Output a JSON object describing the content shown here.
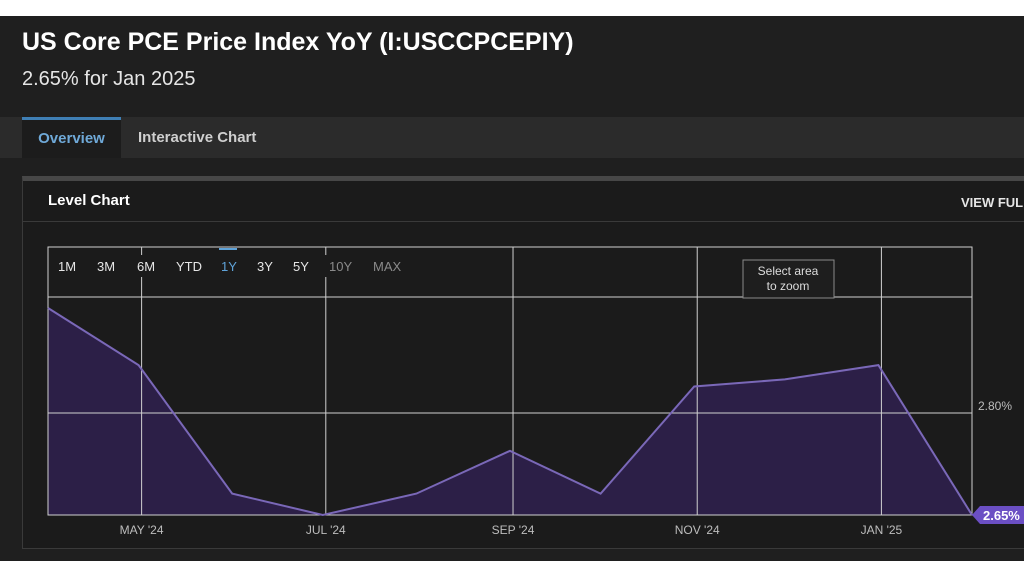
{
  "header": {
    "title": "US Core PCE Price Index YoY (I:USCCPCEPIY)",
    "subtitle": "2.65% for Jan 2025"
  },
  "tabs": [
    {
      "label": "Overview",
      "active": true
    },
    {
      "label": "Interactive Chart",
      "active": false
    }
  ],
  "panel": {
    "title": "Level Chart",
    "view_full_label": "VIEW FUL"
  },
  "range_buttons": [
    {
      "label": "1M",
      "state": "normal"
    },
    {
      "label": "3M",
      "state": "normal"
    },
    {
      "label": "6M",
      "state": "normal"
    },
    {
      "label": "YTD",
      "state": "normal"
    },
    {
      "label": "1Y",
      "state": "selected"
    },
    {
      "label": "3Y",
      "state": "normal"
    },
    {
      "label": "5Y",
      "state": "normal"
    },
    {
      "label": "10Y",
      "state": "disabled"
    },
    {
      "label": "MAX",
      "state": "disabled"
    }
  ],
  "tooltip": {
    "line1": "Select area",
    "line2": "to zoom"
  },
  "colors": {
    "series_line": "#7a68b8",
    "series_fill": "#2c1f47",
    "badge": "#6b4fc4",
    "selected_range": "#5fa3d9",
    "grid": "#d0d0d0"
  },
  "chart_data": {
    "type": "area",
    "x_tick_labels": [
      "MAY '24",
      "JUL '24",
      "SEP '24",
      "NOV '24",
      "JAN '25"
    ],
    "y_tick_labels": [
      "2.80%"
    ],
    "last_value_label": "2.65%",
    "x": [
      "Apr 2024",
      "May 2024",
      "Jun 2024",
      "Jul 2024",
      "Aug 2024",
      "Sep 2024",
      "Oct 2024",
      "Nov 2024",
      "Dec 2024",
      "Jan 2025"
    ],
    "values": [
      2.94,
      2.86,
      2.68,
      2.65,
      2.68,
      2.74,
      2.68,
      2.83,
      2.84,
      2.86,
      2.65
    ],
    "dates": [
      "2024-03-31",
      "2024-04-30",
      "2024-05-31",
      "2024-06-30",
      "2024-07-31",
      "2024-08-31",
      "2024-09-30",
      "2024-10-31",
      "2024-11-30",
      "2024-12-31",
      "2025-01-31"
    ],
    "ylim": [
      2.65,
      2.94
    ],
    "grid": true
  }
}
